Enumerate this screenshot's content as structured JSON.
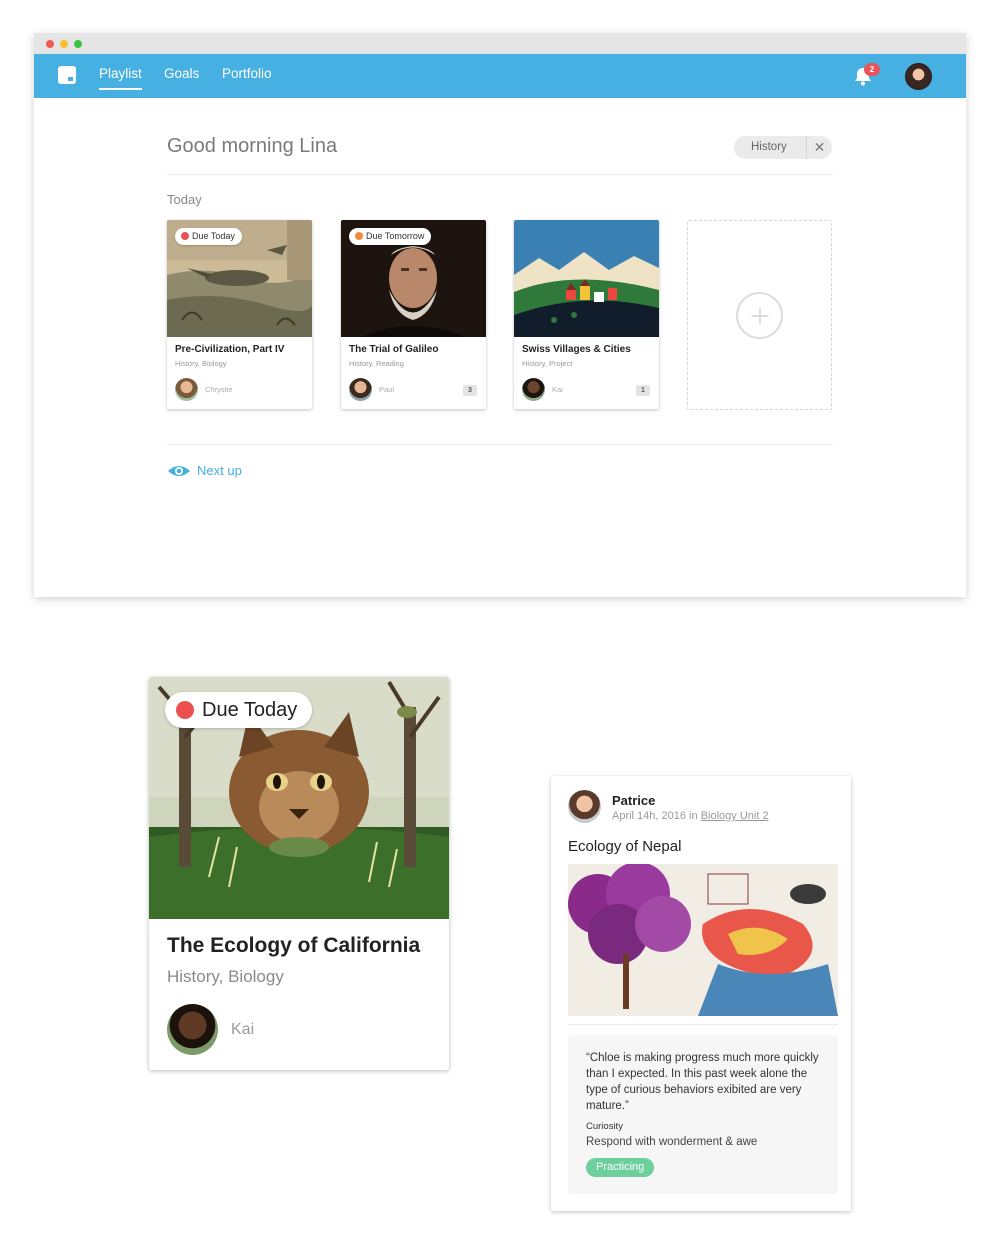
{
  "nav": {
    "items": [
      {
        "label": "Playlist"
      },
      {
        "label": "Goals"
      },
      {
        "label": "Portfolio"
      }
    ],
    "notification_count": "2"
  },
  "main": {
    "greeting": "Good morning Lina",
    "filter_chip": "History",
    "section_label": "Today",
    "next_up_label": "Next up",
    "cards": [
      {
        "due": "Due Today",
        "due_color": "#eb4f4f",
        "title": "Pre-Civilization, Part IV",
        "subjects": "History, Biology",
        "owner": "Chrystie",
        "count": ""
      },
      {
        "due": "Due Tomorrow",
        "due_color": "#f58b3a",
        "title": "The Trial of Galileo",
        "subjects": "History, Reading",
        "owner": "Paul",
        "count": "3"
      },
      {
        "due": "",
        "due_color": "",
        "title": "Swiss Villages & Cities",
        "subjects": "History, Project",
        "owner": "Kai",
        "count": "1"
      }
    ]
  },
  "feature_card": {
    "due": "Due Today",
    "title": "The Ecology of California",
    "subjects": "History, Biology",
    "owner": "Kai"
  },
  "post": {
    "author": "Patrice",
    "meta_prefix": "April 14h, 2016 in",
    "meta_link": "Biology Unit 2",
    "title": "Ecology of Nepal",
    "quote": "“Chloe is making progress much more quickly than I expected. In this past week alone the type of curious behaviors exibited are very mature.”",
    "trait": "Curiosity",
    "trait_desc": "Respond with wonderment & awe",
    "status": "Practicing"
  },
  "colors": {
    "brand": "#45b0e1",
    "due_today": "#eb4f4f",
    "due_tomorrow": "#f58b3a",
    "practicing": "#6ccf9c",
    "badge": "#e9545a"
  }
}
